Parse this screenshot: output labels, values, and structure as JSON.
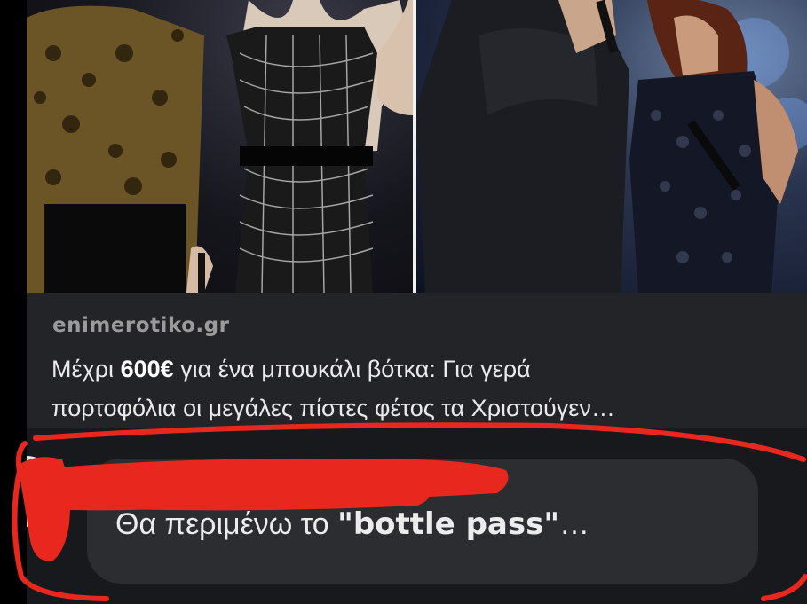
{
  "article": {
    "source": "enimerotiko.gr",
    "title_pre": "Μέχρι ",
    "title_price": "600€",
    "title_post": " για ένα μπουκάλι βότκα: Για γερά",
    "title_line2": "πορτοφόλια οι μεγάλες πίστες φέτος τα Χριστούγεν…"
  },
  "comment": {
    "author": "",
    "text_pre": "Θα περιμένω το ",
    "text_quote": "\"bottle pass\"",
    "text_post": "…"
  },
  "colors": {
    "card_bg": "#232428",
    "bubble_bg": "#2c2d31",
    "marker_red": "#e8281e"
  }
}
